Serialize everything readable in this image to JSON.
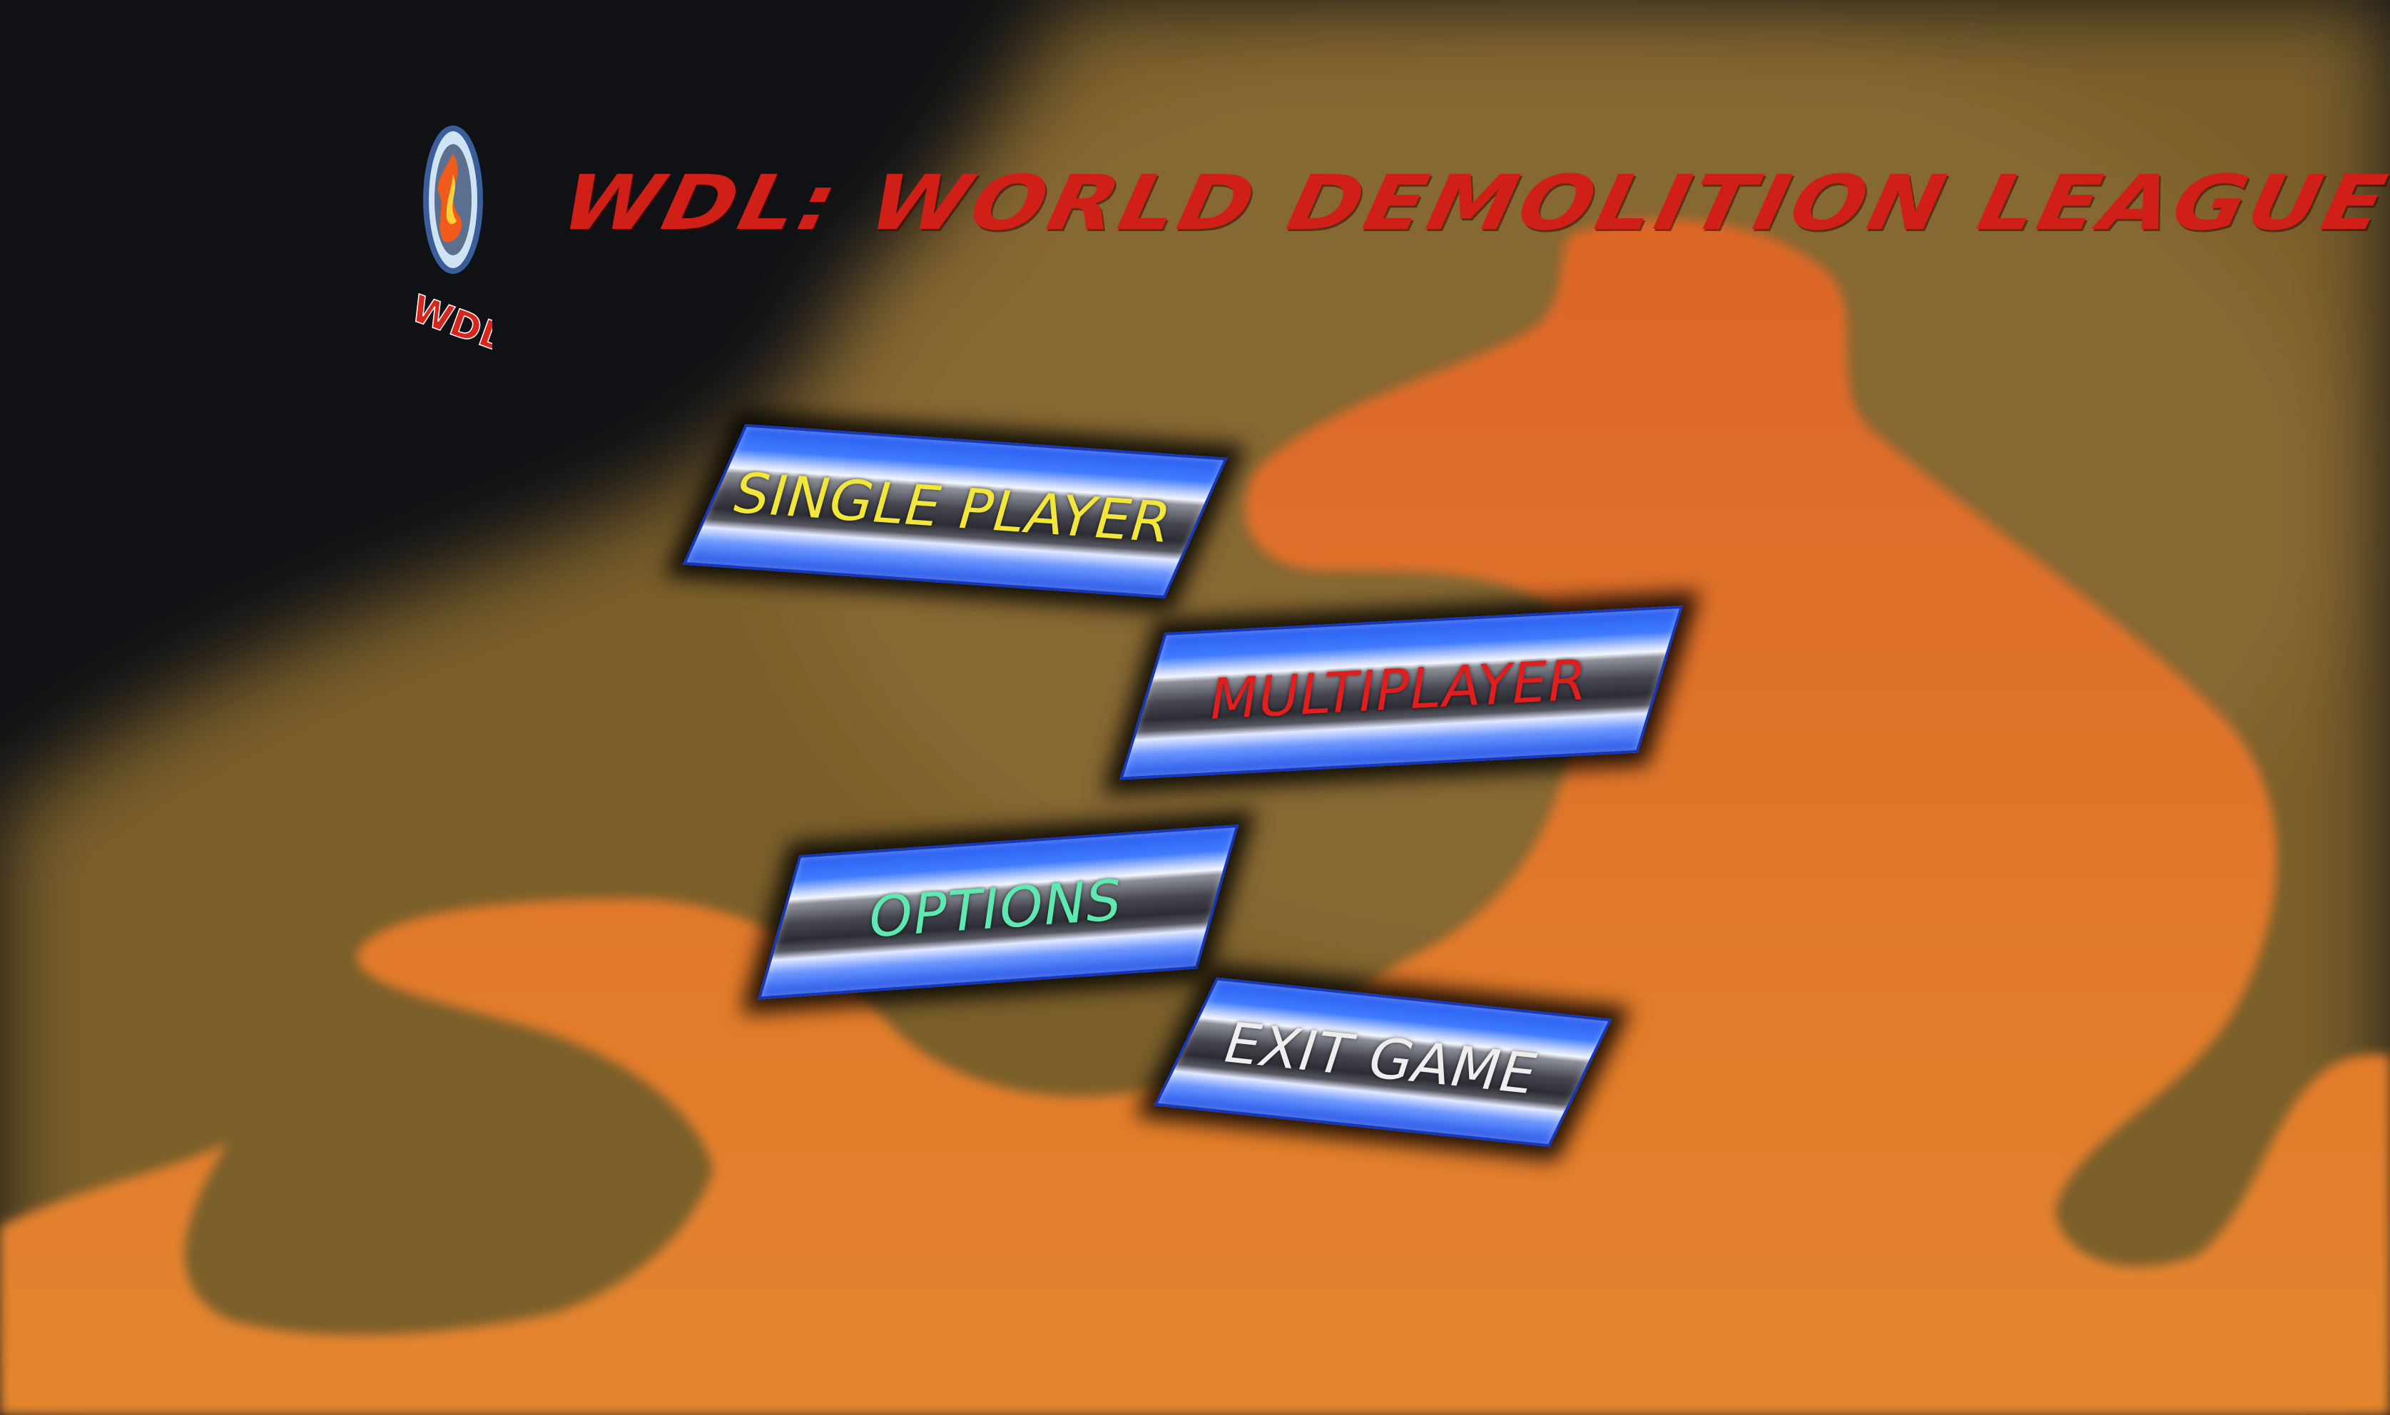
{
  "game": {
    "title": "WDL: WORLD DEMOLITION LEAGUE",
    "logo_text": "WDL",
    "logo_icon": "flaming-shield-logo"
  },
  "menu": {
    "items": [
      {
        "label": "SINGLE PLAYER",
        "color": "#f2e63a"
      },
      {
        "label": "MULTIPLAYER",
        "color": "#e01e1e"
      },
      {
        "label": "OPTIONS",
        "color": "#5fe8b0"
      },
      {
        "label": "EXIT GAME",
        "color": "#eeeeee"
      }
    ]
  },
  "colors": {
    "title": "#d01f16",
    "background_dark": "#0f1115",
    "flame_orange": "#e06a2a",
    "flame_olive": "#8a6a2c",
    "button_blue": "#2a5ef0"
  }
}
